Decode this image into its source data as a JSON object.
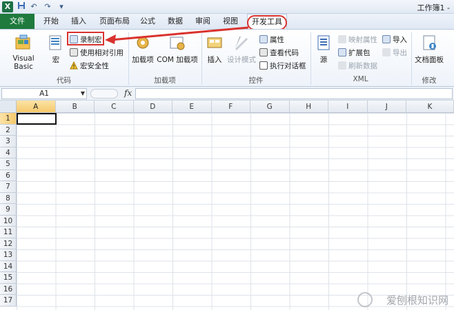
{
  "window": {
    "title": "工作簿1 - "
  },
  "quick_access": {
    "save_icon": "save-icon",
    "undo": "↶",
    "redo": "↷",
    "customize": "▾"
  },
  "tabs": [
    {
      "label": "文件"
    },
    {
      "label": "开始"
    },
    {
      "label": "插入"
    },
    {
      "label": "页面布局"
    },
    {
      "label": "公式"
    },
    {
      "label": "数据"
    },
    {
      "label": "审阅"
    },
    {
      "label": "视图"
    },
    {
      "label": "开发工具"
    }
  ],
  "ribbon": {
    "code": {
      "label": "代码",
      "visual_basic": "Visual Basic",
      "macros": "宏",
      "record_macro": "录制宏",
      "relative_refs": "使用相对引用",
      "macro_security": "宏安全性"
    },
    "addins": {
      "label": "加载项",
      "addins": "加载项",
      "com_addins": "COM 加载项"
    },
    "controls": {
      "label": "控件",
      "insert": "插入",
      "design_mode": "设计模式",
      "properties": "属性",
      "view_code": "查看代码",
      "run_dialog": "执行对话框"
    },
    "xml": {
      "label": "XML",
      "source": "源",
      "map_properties": "映射属性",
      "expansion_packs": "扩展包",
      "refresh_data": "刷新数据",
      "import": "导入",
      "export": "导出"
    },
    "modify": {
      "label": "修改",
      "doc_panel": "文档面板"
    }
  },
  "formula_bar": {
    "name_box": "A1",
    "fx": "fx",
    "value": ""
  },
  "grid": {
    "columns": [
      "A",
      "B",
      "C",
      "D",
      "E",
      "F",
      "G",
      "H",
      "I",
      "J",
      "K"
    ],
    "rows": [
      "1",
      "2",
      "3",
      "4",
      "5",
      "6",
      "7",
      "8",
      "9",
      "10",
      "11",
      "12",
      "13",
      "14",
      "15",
      "16",
      "17"
    ],
    "active_cell": "A1"
  },
  "watermark": "爱刨根知识网",
  "colors": {
    "accent_red": "#d9322e",
    "file_tab": "#1f7a3d",
    "selected_header": "#f6c96a"
  }
}
